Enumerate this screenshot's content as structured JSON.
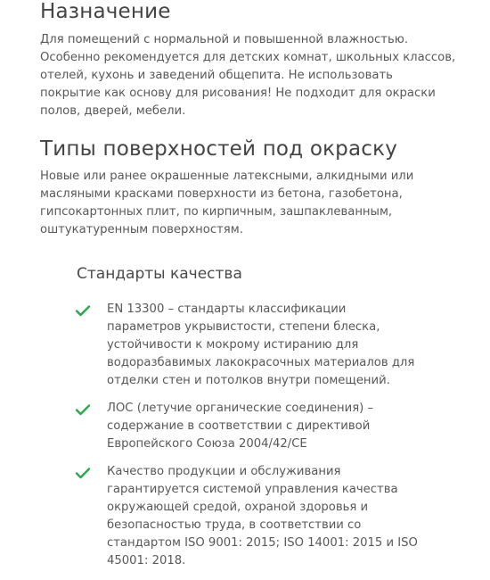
{
  "purpose": {
    "title": "Назначение",
    "lines": [
      "Для помещений с нормальной и повышенной влажностью.",
      "Особенно рекомендуется для детских комнат, школьных классов,",
      "отелей, кухонь и заведений общепита. Не использовать",
      "покрытие как основу для рисования! Не подходит для окраски",
      "полов, дверей, мебели."
    ]
  },
  "surfaces": {
    "title": "Типы поверхностей под окраску",
    "lines": [
      "Новые или ранее окрашенные латексными, алкидными или",
      "масляными красками поверхности из бетона, газобетона,",
      "гипсокартонных плит, по кирпичным, зашпаклеванным,",
      "оштукатуренным поверхностям."
    ]
  },
  "standards": {
    "title": "Стандарты качества",
    "check_color": "#2aa84a",
    "items": [
      {
        "icon": "check-icon",
        "lines": [
          "EN 13300  – стандарты классификации",
          "параметров укрывистости, степени блеска,",
          "устойчивости к  мокрому истиранию для",
          "водоразбавимых лакокрасочных материалов для",
          "отделки стен и потолков внутри помещений."
        ]
      },
      {
        "icon": "check-icon",
        "lines": [
          "ЛОС (летучие органические соединения) –",
          "содержание в соответствии с директивой",
          "Европейского Союза 2004/42/CE"
        ]
      },
      {
        "icon": "check-icon",
        "lines": [
          "Качество продукции и обслуживания",
          "гарантируется системой управления качества",
          "окружающей средой, охраной здоровья и",
          "безопасностью труда, в соответствии со",
          "стандартом ISO 9001: 2015; ISO 14001: 2015 и ISO",
          "45001: 2018."
        ]
      }
    ]
  }
}
